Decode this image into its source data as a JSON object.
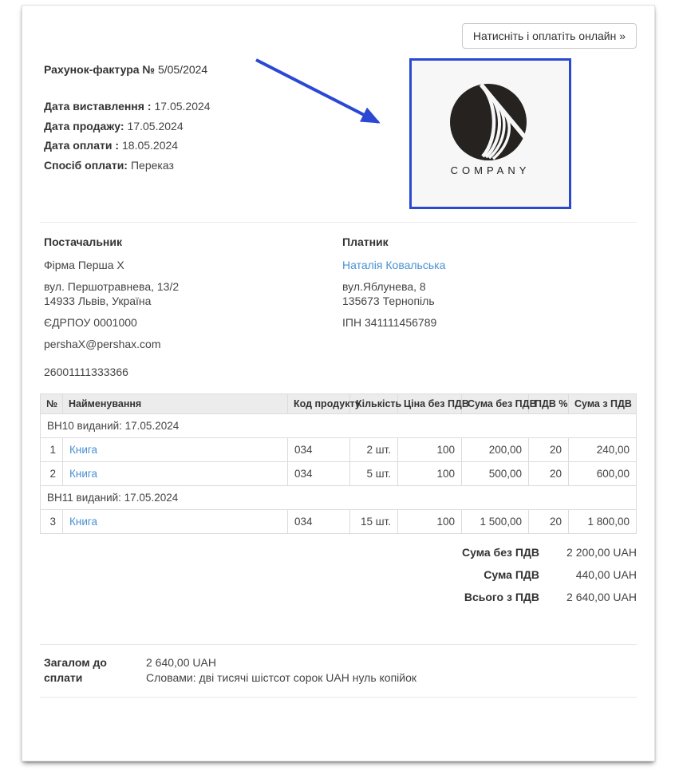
{
  "header": {
    "pay_button_label": "Натисніть і оплатіть онлайн »",
    "invoice_label": "Рахунок-фактура №",
    "invoice_number": "5/05/2024",
    "fields": [
      {
        "label": "Дата виставлення :",
        "value": "17.05.2024"
      },
      {
        "label": "Дата продажу:",
        "value": "17.05.2024"
      },
      {
        "label": "Дата оплати :",
        "value": "18.05.2024"
      },
      {
        "label": "Спосіб оплати:",
        "value": "Переказ"
      }
    ],
    "logo_text": "COMPANY"
  },
  "parties": {
    "supplier": {
      "title": "Постачальник",
      "name": "Фірма Перша X",
      "address_line1": "вул. Першотравнева, 13/2",
      "address_line2": "14933 Львів, Україна",
      "tax_id": "ЄДРПОУ 0001000",
      "email": "pershaX@pershax.com",
      "account": "26001111333366"
    },
    "payer": {
      "title": "Платник",
      "name": "Наталія Ковальська",
      "address_line1": "вул.Яблунева, 8",
      "address_line2": "135673 Тернопіль",
      "tax_id": "ІПН 341111456789"
    }
  },
  "table": {
    "columns": [
      "№",
      "Найменування",
      "Код продукту",
      "Кількість",
      "Ціна без ПДВ",
      "Сума без ПДВ",
      "ПДВ %",
      "Сума з ПДВ"
    ],
    "groups": [
      {
        "header": "ВН10 виданий: 17.05.2024",
        "rows": [
          {
            "num": "1",
            "name": "Книга",
            "code": "034",
            "qty": "2 шт.",
            "price": "100",
            "sum_net": "200,00",
            "vat": "20",
            "sum_gross": "240,00"
          },
          {
            "num": "2",
            "name": "Книга",
            "code": "034",
            "qty": "5 шт.",
            "price": "100",
            "sum_net": "500,00",
            "vat": "20",
            "sum_gross": "600,00"
          }
        ]
      },
      {
        "header": "ВН11 виданий: 17.05.2024",
        "rows": [
          {
            "num": "3",
            "name": "Книга",
            "code": "034",
            "qty": "15 шт.",
            "price": "100",
            "sum_net": "1 500,00",
            "vat": "20",
            "sum_gross": "1 800,00"
          }
        ]
      }
    ]
  },
  "totals": [
    {
      "label": "Сума без ПДВ",
      "value": "2 200,00 UAH"
    },
    {
      "label": "Сума ПДВ",
      "value": "440,00 UAH"
    },
    {
      "label": "Всього з ПДВ",
      "value": "2 640,00 UAH"
    }
  ],
  "footer": {
    "total_label": "Загалом до сплати",
    "total_value": "2 640,00 UAH",
    "total_words": "Словами: дві тисячі шістсот сорок UAH нуль копійок"
  },
  "colors": {
    "accent_blue": "#2b48d3",
    "link_blue": "#4a90d2"
  }
}
